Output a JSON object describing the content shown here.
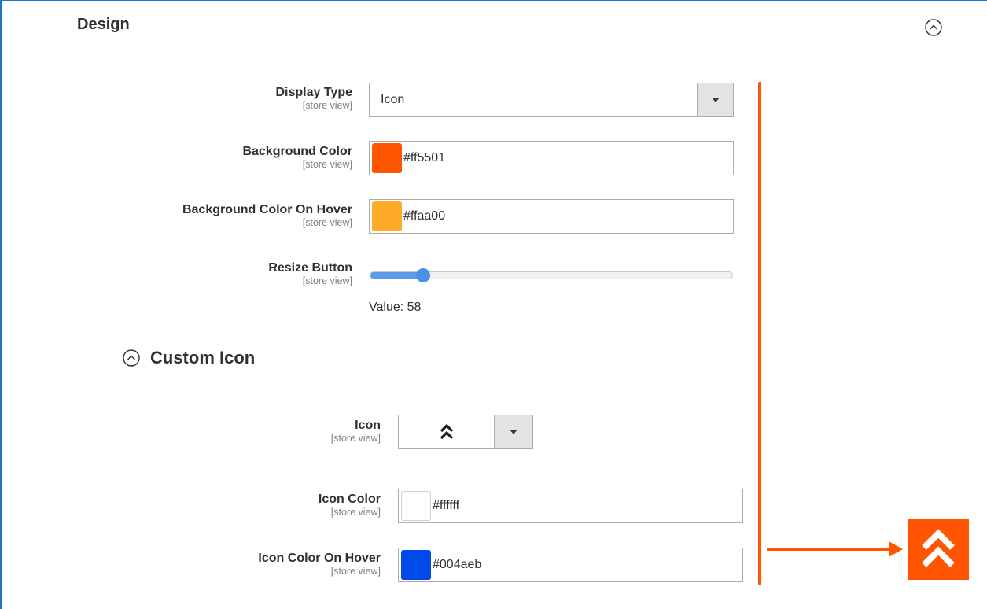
{
  "section": {
    "title": "Design"
  },
  "fields": {
    "display_type": {
      "label": "Display Type",
      "scope": "[store view]",
      "value": "Icon"
    },
    "background_color": {
      "label": "Background Color",
      "scope": "[store view]",
      "value": "#ff5501",
      "swatch": "#ff5501"
    },
    "background_hover": {
      "label": "Background Color On Hover",
      "scope": "[store view]",
      "value": "#ffaa00",
      "swatch": "#ffaa00"
    },
    "resize_button": {
      "label": "Resize Button",
      "scope": "[store view]",
      "value_text": "Value: 58",
      "value": 58,
      "min": 0,
      "max": 100
    }
  },
  "custom_icon": {
    "title": "Custom Icon",
    "icon": {
      "label": "Icon",
      "scope": "[store view]",
      "selected_icon": "double-chevron-up-icon"
    },
    "icon_color": {
      "label": "Icon Color",
      "scope": "[store view]",
      "value": "#ffffff",
      "swatch": "#ffffff"
    },
    "icon_color_hover": {
      "label": "Icon Color On Hover",
      "scope": "[store view]",
      "value": "#004aeb",
      "swatch": "#004aeb"
    }
  },
  "preview": {
    "background": "#ff5501",
    "icon": "double-chevron-up-icon",
    "icon_color": "#ffffff"
  },
  "accent": "#ff5501"
}
